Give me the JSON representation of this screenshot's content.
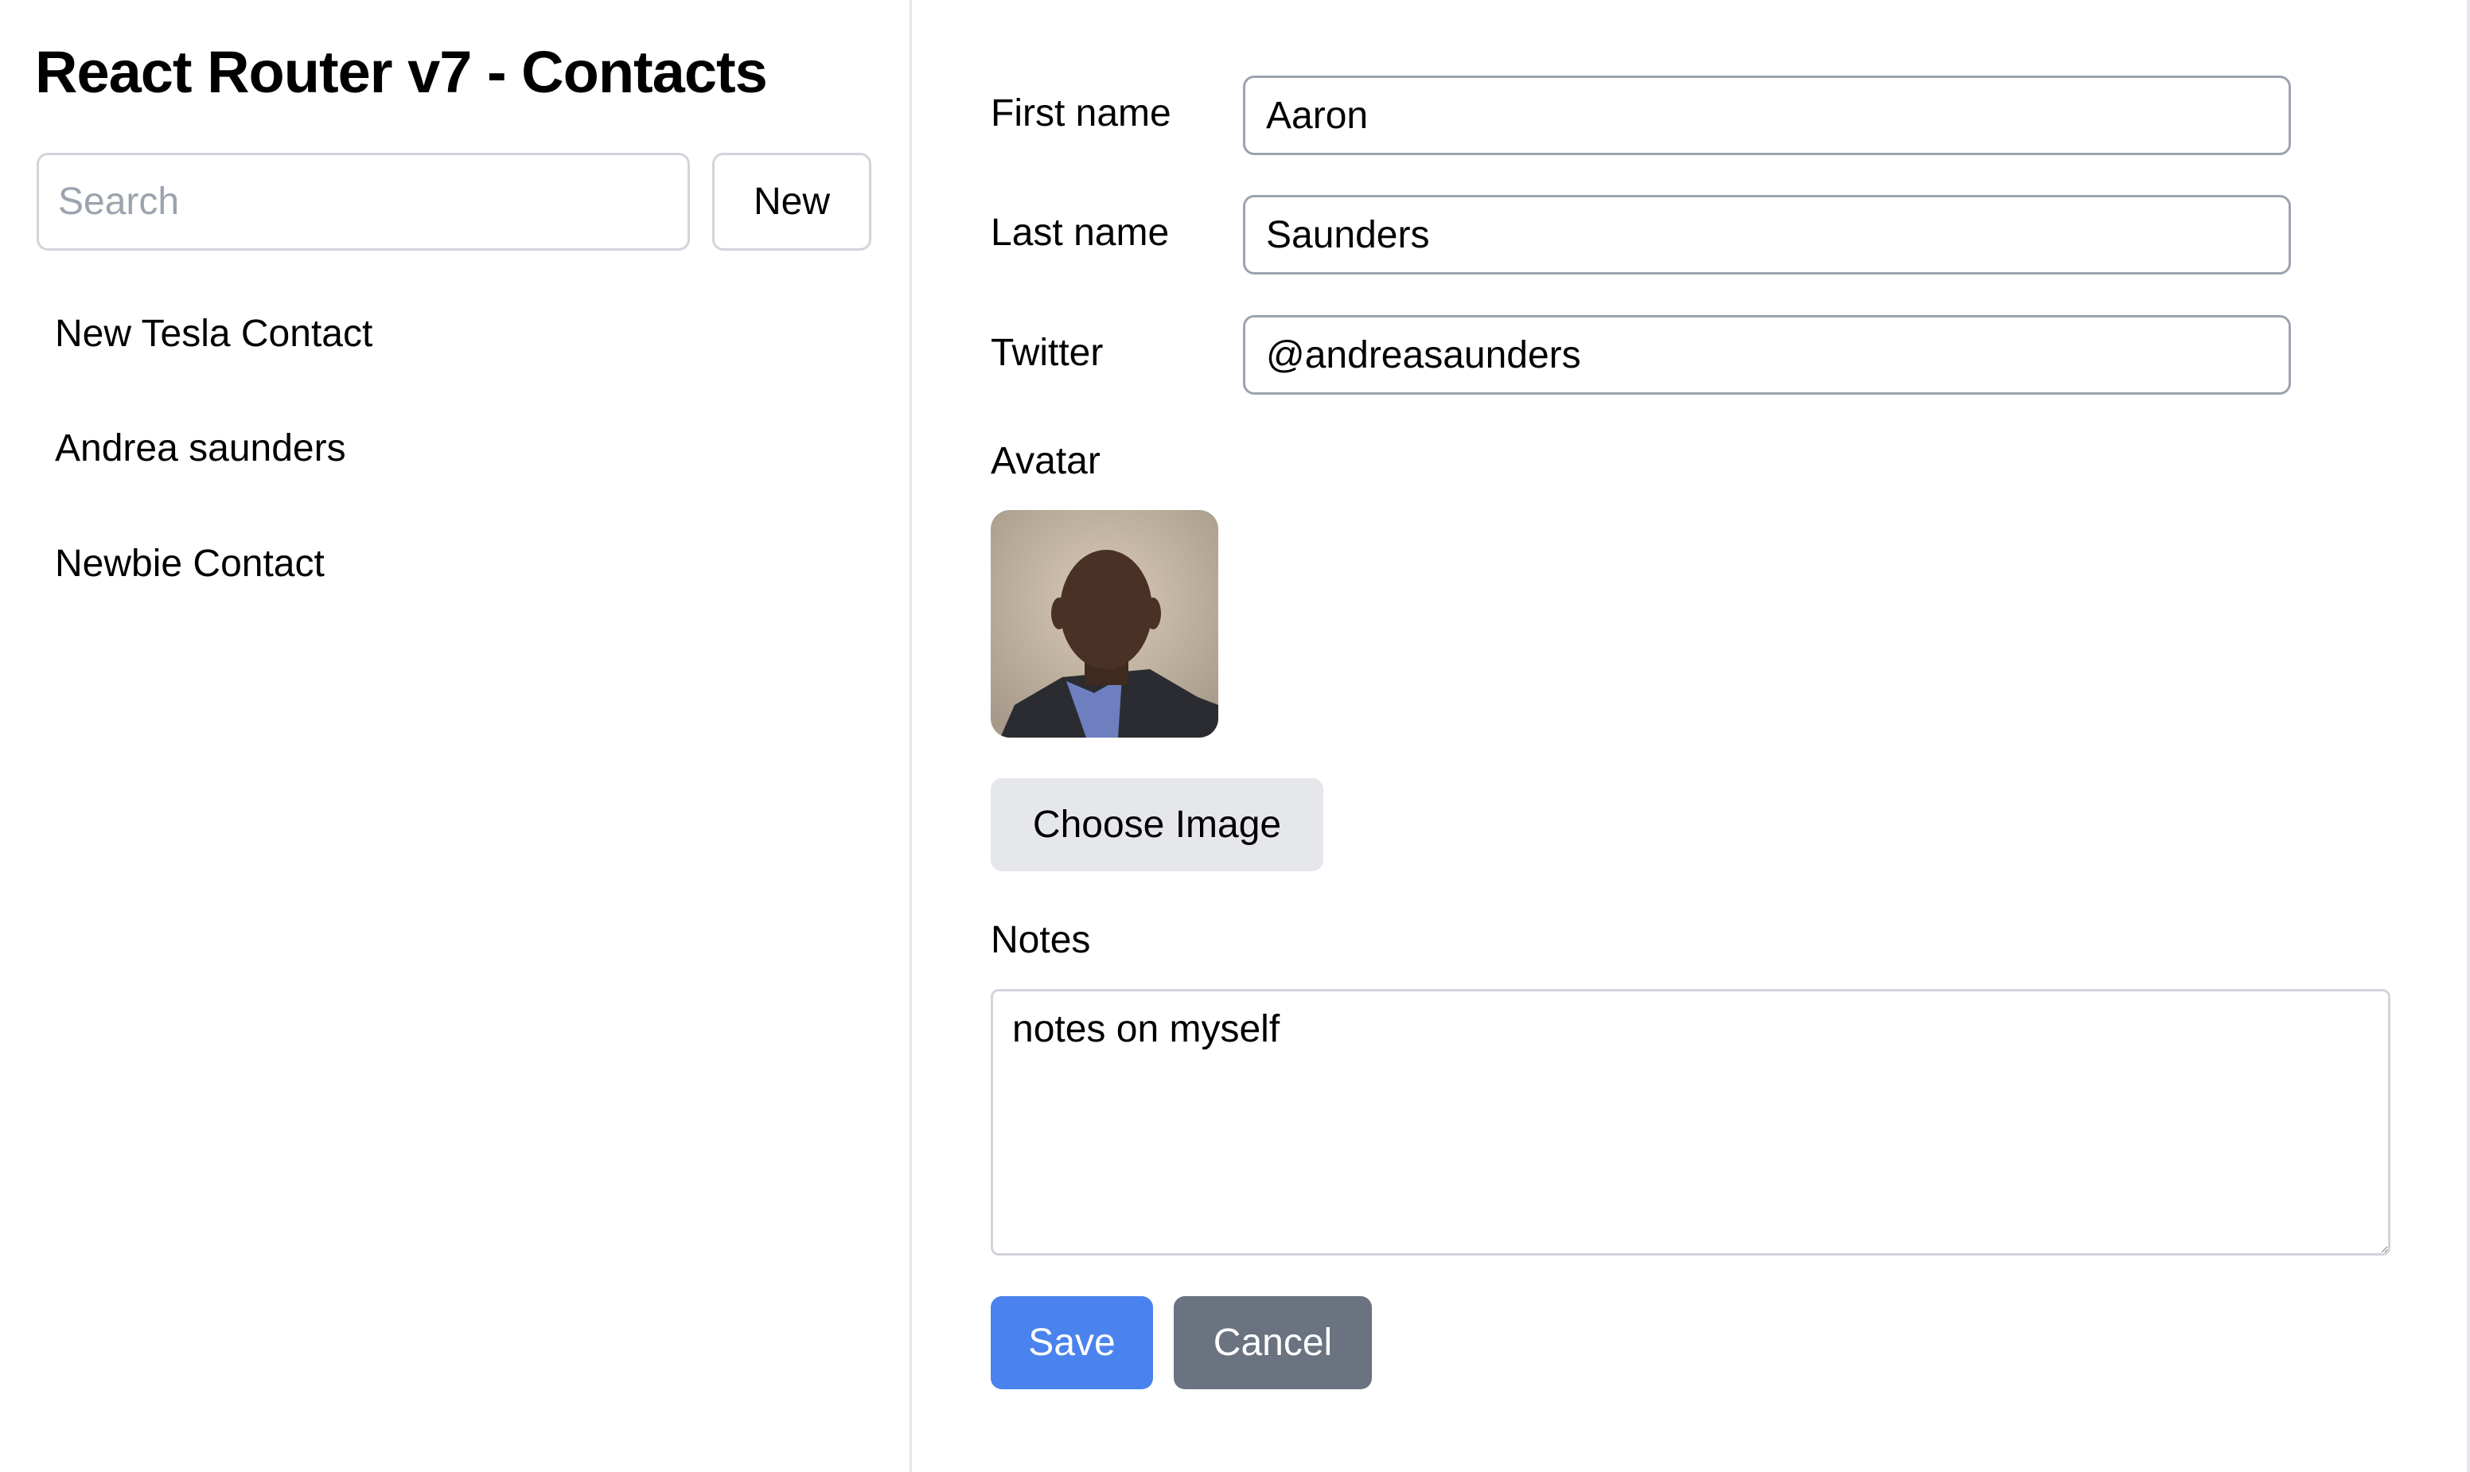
{
  "sidebar": {
    "title": "React Router v7 - Contacts",
    "search_placeholder": "Search",
    "new_label": "New",
    "contacts": [
      "New Tesla Contact",
      "Andrea saunders",
      "Newbie Contact"
    ]
  },
  "form": {
    "first_name_label": "First name",
    "first_name_value": "Aaron",
    "last_name_label": "Last name",
    "last_name_value": "Saunders",
    "twitter_label": "Twitter",
    "twitter_value": "@andreasaunders",
    "avatar_label": "Avatar",
    "choose_image_label": "Choose Image",
    "notes_label": "Notes",
    "notes_value": "notes on myself",
    "save_label": "Save",
    "cancel_label": "Cancel"
  },
  "colors": {
    "save": "#4b83ee",
    "cancel": "#6b7280",
    "choose": "#e5e7eb"
  }
}
